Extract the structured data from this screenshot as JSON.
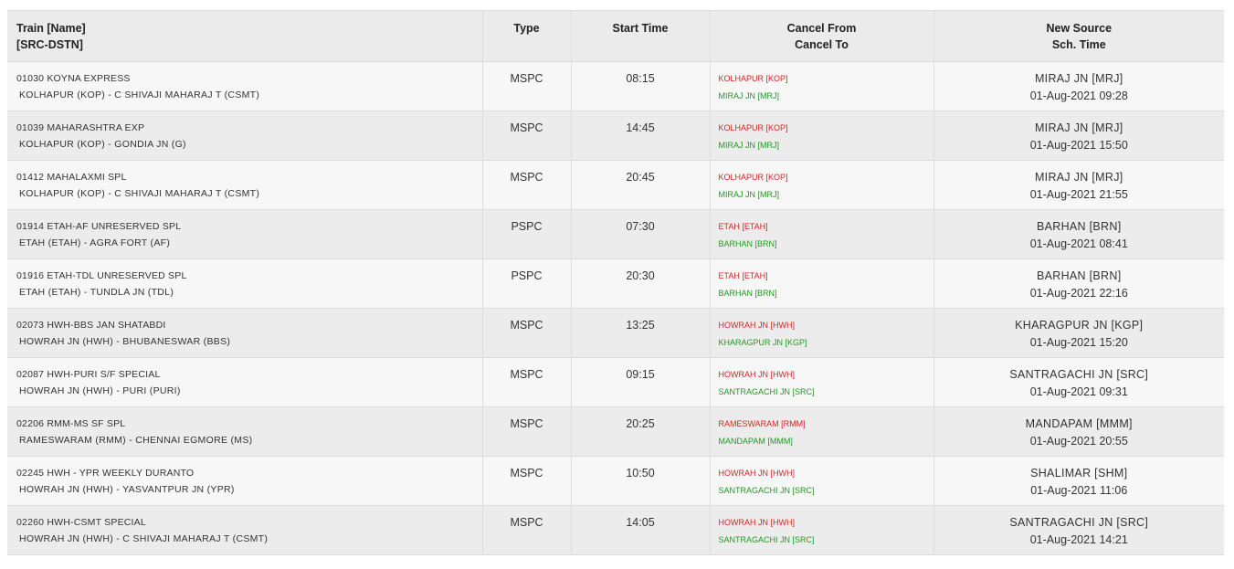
{
  "table": {
    "headers": {
      "train_line1": "Train [Name]",
      "train_line2": "[SRC-DSTN]",
      "type": "Type",
      "start_time": "Start Time",
      "cancel_line1": "Cancel From",
      "cancel_line2": "Cancel To",
      "source_line1": "New Source",
      "source_line2": "Sch. Time"
    },
    "rows": [
      {
        "name": "01030 KOYNA EXPRESS",
        "route": "KOLHAPUR (KOP) - C SHIVAJI MAHARAJ T (CSMT)",
        "type": "MSPC",
        "start": "08:15",
        "cancel_from": "KOLHAPUR [KOP]",
        "cancel_to": "MIRAJ JN [MRJ]",
        "new_source": "MIRAJ JN [MRJ]",
        "sch_time": "01-Aug-2021 09:28"
      },
      {
        "name": "01039 MAHARASHTRA EXP",
        "route": "KOLHAPUR (KOP) - GONDIA JN (G)",
        "type": "MSPC",
        "start": "14:45",
        "cancel_from": "KOLHAPUR [KOP]",
        "cancel_to": "MIRAJ JN [MRJ]",
        "new_source": "MIRAJ JN [MRJ]",
        "sch_time": "01-Aug-2021 15:50"
      },
      {
        "name": "01412 MAHALAXMI SPL",
        "route": "KOLHAPUR (KOP) - C SHIVAJI MAHARAJ T (CSMT)",
        "type": "MSPC",
        "start": "20:45",
        "cancel_from": "KOLHAPUR [KOP]",
        "cancel_to": "MIRAJ JN [MRJ]",
        "new_source": "MIRAJ JN [MRJ]",
        "sch_time": "01-Aug-2021 21:55"
      },
      {
        "name": "01914 ETAH-AF UNRESERVED SPL",
        "route": "ETAH (ETAH) - AGRA FORT (AF)",
        "type": "PSPC",
        "start": "07:30",
        "cancel_from": "ETAH [ETAH]",
        "cancel_to": "BARHAN [BRN]",
        "new_source": "BARHAN [BRN]",
        "sch_time": "01-Aug-2021 08:41"
      },
      {
        "name": "01916 ETAH-TDL UNRESERVED SPL",
        "route": "ETAH (ETAH) - TUNDLA JN (TDL)",
        "type": "PSPC",
        "start": "20:30",
        "cancel_from": "ETAH [ETAH]",
        "cancel_to": "BARHAN [BRN]",
        "new_source": "BARHAN [BRN]",
        "sch_time": "01-Aug-2021 22:16"
      },
      {
        "name": "02073 HWH-BBS JAN SHATABDI",
        "route": "HOWRAH JN (HWH) - BHUBANESWAR (BBS)",
        "type": "MSPC",
        "start": "13:25",
        "cancel_from": "HOWRAH JN [HWH]",
        "cancel_to": "KHARAGPUR JN [KGP]",
        "new_source": "KHARAGPUR JN [KGP]",
        "sch_time": "01-Aug-2021 15:20"
      },
      {
        "name": "02087 HWH-PURI S/F SPECIAL",
        "route": "HOWRAH JN (HWH) - PURI (PURI)",
        "type": "MSPC",
        "start": "09:15",
        "cancel_from": "HOWRAH JN [HWH]",
        "cancel_to": "SANTRAGACHI JN [SRC]",
        "new_source": "SANTRAGACHI JN [SRC]",
        "sch_time": "01-Aug-2021 09:31"
      },
      {
        "name": "02206 RMM-MS SF SPL",
        "route": "RAMESWARAM (RMM) - CHENNAI EGMORE (MS)",
        "type": "MSPC",
        "start": "20:25",
        "cancel_from": "RAMESWARAM [RMM]",
        "cancel_to": "MANDAPAM [MMM]",
        "new_source": "MANDAPAM [MMM]",
        "sch_time": "01-Aug-2021 20:55"
      },
      {
        "name": "02245 HWH - YPR WEEKLY DURANTO",
        "route": "HOWRAH JN (HWH) - YASVANTPUR JN (YPR)",
        "type": "MSPC",
        "start": "10:50",
        "cancel_from": "HOWRAH JN [HWH]",
        "cancel_to": "SANTRAGACHI JN [SRC]",
        "new_source": "SHALIMAR [SHM]",
        "sch_time": "01-Aug-2021 11:06"
      },
      {
        "name": "02260 HWH-CSMT SPECIAL",
        "route": "HOWRAH JN (HWH) - C SHIVAJI MAHARAJ T (CSMT)",
        "type": "MSPC",
        "start": "14:05",
        "cancel_from": "HOWRAH JN [HWH]",
        "cancel_to": "SANTRAGACHI JN [SRC]",
        "new_source": "SANTRAGACHI JN [SRC]",
        "sch_time": "01-Aug-2021 14:21"
      }
    ]
  },
  "colors": {
    "cancel_from": "#dd1f1f",
    "cancel_to": "#1f9a1f",
    "header_bg": "#ebebeb",
    "row_odd": "#f7f7f7",
    "row_even": "#ececec"
  }
}
